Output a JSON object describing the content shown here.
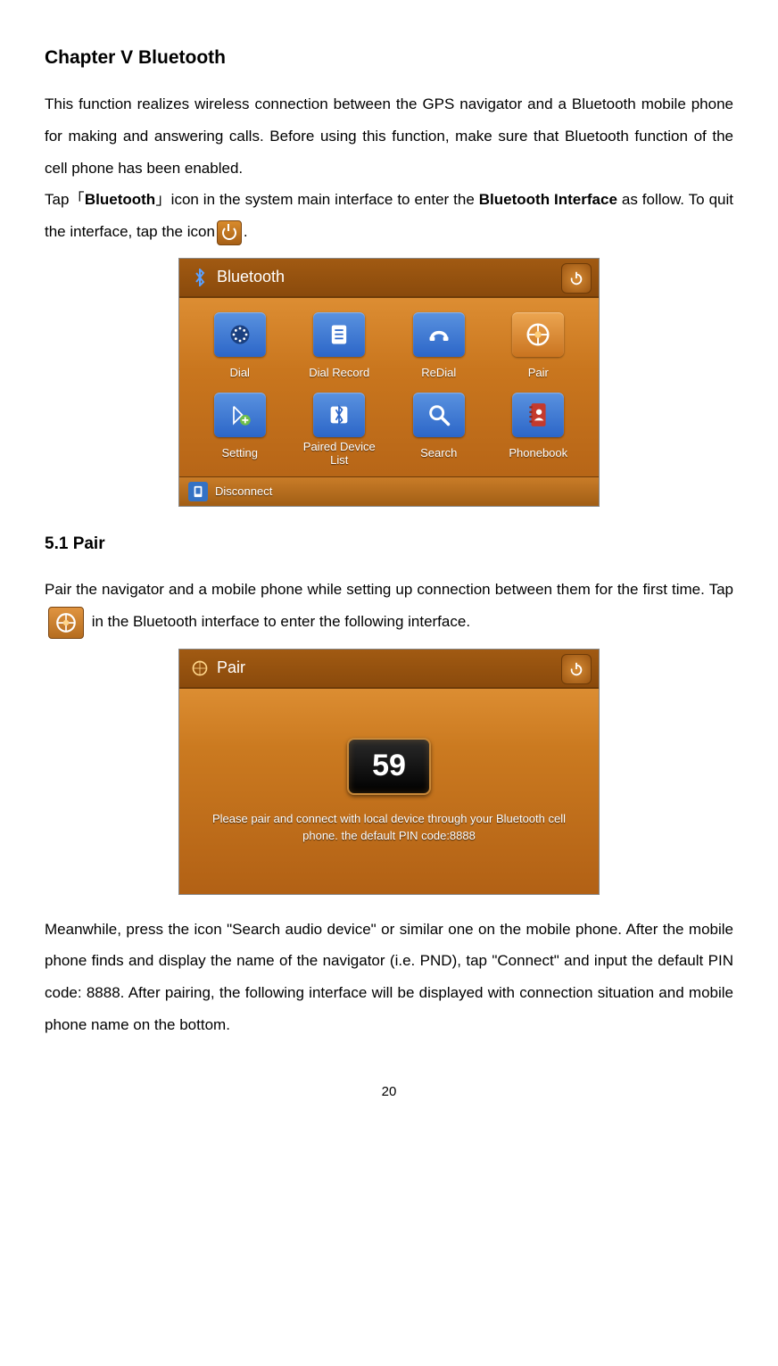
{
  "chapter_title": "Chapter V Bluetooth",
  "intro": "This function realizes wireless connection between the GPS navigator and a Bluetooth mobile phone for making and answering calls. Before using this function, make sure that Bluetooth function of the cell phone has been enabled.",
  "tap_line_pre": "Tap「",
  "tap_bold": "Bluetooth",
  "tap_line_mid": "」icon in the system main interface to enter the ",
  "tap_bold2": "Bluetooth Interface",
  "tap_line_post": " as follow. To quit the interface, tap the icon",
  "tap_line_end": ".",
  "bt_screen": {
    "title": "Bluetooth",
    "items": [
      {
        "label": "Dial",
        "color": "#2c66c8"
      },
      {
        "label": "Dial Record",
        "color": "#2c66c8"
      },
      {
        "label": "ReDial",
        "color": "#2c66c8"
      },
      {
        "label": "Pair",
        "color": "#e0862e"
      },
      {
        "label": "Setting",
        "color": "#2c66c8"
      },
      {
        "label": "Paired Device\nList",
        "color": "#2c66c8"
      },
      {
        "label": "Search",
        "color": "#2c66c8"
      },
      {
        "label": "Phonebook",
        "color": "#2c66c8"
      }
    ],
    "footer": "Disconnect"
  },
  "section_pair": "5.1 Pair",
  "pair_p1_pre": "Pair the navigator and a mobile phone while setting up connection between them for the first time. Tap ",
  "pair_p1_post": " in the Bluetooth interface to enter the following interface.",
  "pair_screen": {
    "title": "Pair",
    "countdown": "59",
    "message": "Please pair and connect with local device through your Bluetooth cell phone. the default PIN code:8888"
  },
  "pair_p2": "Meanwhile, press the icon \"Search audio device\" or similar one on the mobile phone. After the mobile phone finds and display the name of the navigator (i.e. PND), tap \"Connect\" and input the default PIN code: 8888. After pairing, the following interface will be displayed with connection situation and mobile phone name on the bottom.",
  "page_number": "20"
}
